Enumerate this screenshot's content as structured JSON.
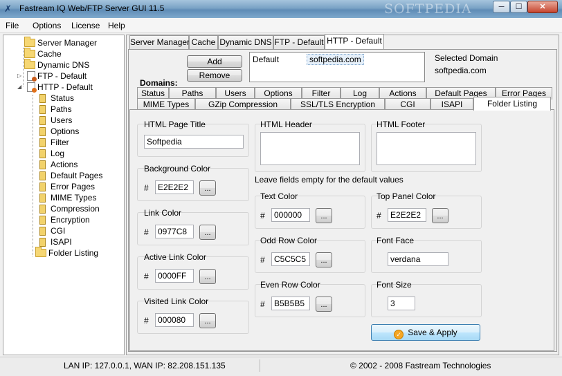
{
  "window": {
    "title": "Fastream IQ Web/FTP Server GUI 11.5",
    "watermark": "SOFTPEDIA",
    "minimize_label": "─",
    "maximize_label": "☐",
    "close_label": "✕"
  },
  "menu": [
    "File",
    "Options",
    "License",
    "Help"
  ],
  "tree": {
    "top_items": [
      "Server Manager",
      "Cache",
      "Dynamic DNS",
      "FTP - Default",
      "HTTP - Default"
    ],
    "http_children": [
      "Status",
      "Paths",
      "Users",
      "Options",
      "Filter",
      "Log",
      "Actions",
      "Default Pages",
      "Error Pages",
      "MIME Types",
      "Compression",
      "Encryption",
      "CGI",
      "ISAPI",
      "Folder Listing"
    ]
  },
  "main_tabs": [
    "Server Manager",
    "Cache",
    "Dynamic DNS",
    "FTP - Default",
    "HTTP - Default"
  ],
  "domains": {
    "label": "Domains:",
    "add_label": "Add",
    "remove_label": "Remove",
    "list": [
      {
        "name": "Default",
        "value": "softpedia.com"
      }
    ],
    "selected_label": "Selected Domain",
    "selected_value": "softpedia.com"
  },
  "sub_tabs_row1": [
    "Status",
    "Paths",
    "Users",
    "Options",
    "Filter",
    "Log",
    "Actions",
    "Default Pages",
    "Error Pages"
  ],
  "sub_tabs_row2": [
    "MIME Types",
    "GZip Compression",
    "SSL/TLS Encryption",
    "CGI",
    "ISAPI",
    "Folder Listing"
  ],
  "folder_listing": {
    "html_page_title_label": "HTML Page Title",
    "html_page_title_value": "Softpedia",
    "html_header_label": "HTML Header",
    "html_footer_label": "HTML Footer",
    "hint": "Leave fields empty for the default values",
    "hash": "#",
    "browse_label": "...",
    "background_color_label": "Background Color",
    "background_color_value": "E2E2E2",
    "link_color_label": "Link Color",
    "link_color_value": "0977C8",
    "active_link_color_label": "Active Link Color",
    "active_link_color_value": "0000FF",
    "visited_link_color_label": "Visited Link Color",
    "visited_link_color_value": "000080",
    "text_color_label": "Text Color",
    "text_color_value": "000000",
    "odd_row_color_label": "Odd Row Color",
    "odd_row_color_value": "C5C5C5",
    "even_row_color_label": "Even Row Color",
    "even_row_color_value": "B5B5B5",
    "top_panel_color_label": "Top Panel Color",
    "top_panel_color_value": "E2E2E2",
    "font_face_label": "Font Face",
    "font_face_value": "verdana",
    "font_size_label": "Font Size",
    "font_size_value": "3",
    "save_label": "Save & Apply"
  },
  "status": {
    "left": "LAN IP: 127.0.0.1, WAN IP: 82.208.151.135",
    "right": "© 2002 - 2008 Fastream Technologies"
  }
}
